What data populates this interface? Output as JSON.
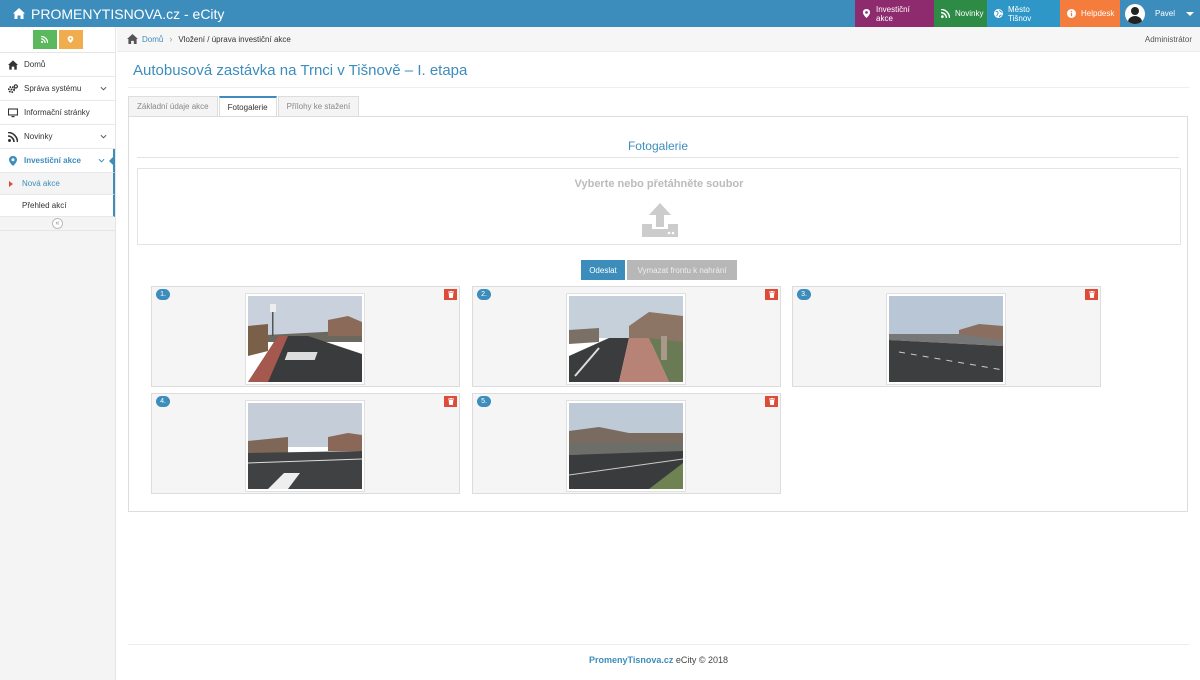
{
  "header": {
    "brand": "PROMENYTISNOVA.cz - eCity",
    "nav": [
      {
        "label": "Investiční akce",
        "icon": "map-marker-icon",
        "color": "#8e2a6e"
      },
      {
        "label": "Novinky",
        "icon": "rss-icon",
        "color": "#2e8b46"
      },
      {
        "label": "Město Tišnov",
        "icon": "globe-icon",
        "color": "#2f96c8"
      },
      {
        "label": "Helpdesk",
        "icon": "info-icon",
        "color": "#f47c3c"
      }
    ],
    "user": {
      "name": "Pavel"
    }
  },
  "sidebar": {
    "items": [
      {
        "label": "Domů",
        "icon": "home-icon"
      },
      {
        "label": "Správa systému",
        "icon": "cogs-icon"
      },
      {
        "label": "Informační stránky",
        "icon": "monitor-icon"
      },
      {
        "label": "Novinky",
        "icon": "rss-icon"
      },
      {
        "label": "Investiční akce",
        "icon": "map-marker-icon"
      }
    ],
    "subitems": [
      {
        "label": "Nová akce"
      },
      {
        "label": "Přehled akcí"
      }
    ],
    "collapse_glyph": "«"
  },
  "breadcrumb": {
    "home": "Domů",
    "current": "Vložení / úprava investiční akce",
    "separator": "›",
    "role": "Administrátor"
  },
  "page": {
    "title": "Autobusová zastávka na Trnci v Tišnově – I. etapa",
    "tabs": [
      {
        "label": "Základní údaje akce"
      },
      {
        "label": "Fotogalerie"
      },
      {
        "label": "Přílohy ke stažení"
      }
    ]
  },
  "gallery": {
    "title": "Fotogalerie",
    "dropzone_text": "Vyberte nebo přetáhněte soubor",
    "send_button": "Odeslat",
    "clear_button": "Vymazat frontu k nahrání",
    "photos": [
      {
        "number": "1."
      },
      {
        "number": "2."
      },
      {
        "number": "3."
      },
      {
        "number": "4."
      },
      {
        "number": "5."
      }
    ]
  },
  "footer": {
    "link": "PromenyTisnova.cz",
    "text": " eCity © 2018"
  },
  "colors": {
    "primary": "#3c8dbc",
    "danger": "#dd4b39"
  }
}
